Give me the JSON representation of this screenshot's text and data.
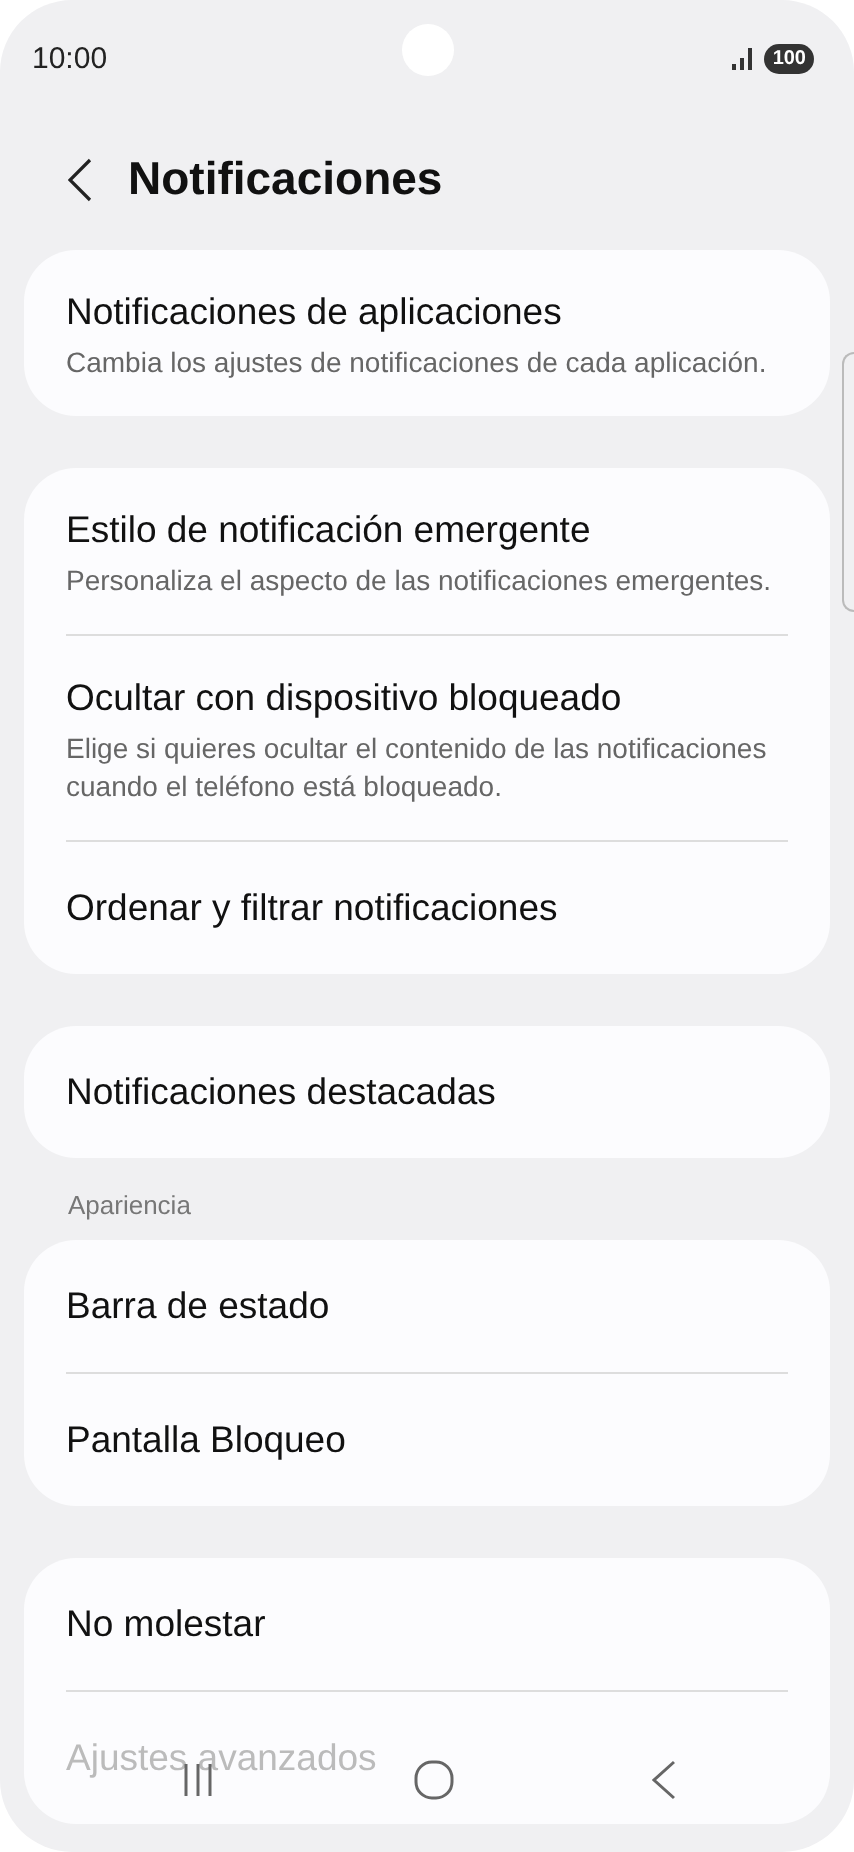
{
  "status_bar": {
    "time": "10:00",
    "battery": "100"
  },
  "header": {
    "title": "Notificaciones"
  },
  "groups": [
    {
      "items": [
        {
          "title": "Notificaciones de aplicaciones",
          "subtitle": "Cambia los ajustes de notificaciones de cada aplicación."
        }
      ]
    },
    {
      "items": [
        {
          "title": "Estilo de notificación emergente",
          "subtitle": "Personaliza el aspecto de las notificaciones emergentes."
        },
        {
          "title": "Ocultar con dispositivo bloqueado",
          "subtitle": "Elige si quieres ocultar el contenido de las notificaciones cuando el teléfono está bloqueado."
        },
        {
          "title": "Ordenar y filtrar notificaciones"
        }
      ]
    },
    {
      "items": [
        {
          "title": "Notificaciones destacadas"
        }
      ]
    },
    {
      "label": "Apariencia",
      "items": [
        {
          "title": "Barra de estado"
        },
        {
          "title": "Pantalla Bloqueo"
        }
      ]
    },
    {
      "items": [
        {
          "title": "No molestar"
        },
        {
          "title": "Ajustes avanzados",
          "faded": true
        }
      ]
    }
  ]
}
